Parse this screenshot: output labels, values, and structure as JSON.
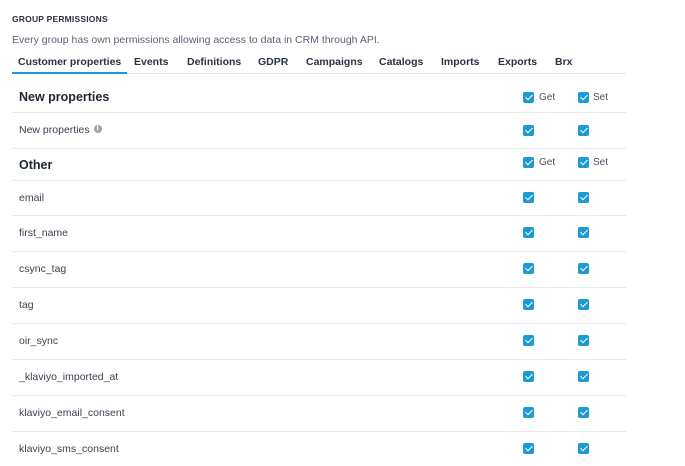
{
  "section": {
    "title": "GROUP PERMISSIONS",
    "description": "Every group has own permissions allowing access to data in CRM through API."
  },
  "tabs": [
    {
      "label": "Customer properties",
      "active": true
    },
    {
      "label": "Events"
    },
    {
      "label": "Definitions"
    },
    {
      "label": "GDPR"
    },
    {
      "label": "Campaigns"
    },
    {
      "label": "Catalogs"
    },
    {
      "label": "Imports"
    },
    {
      "label": "Exports"
    },
    {
      "label": "Brx"
    }
  ],
  "columns": {
    "get": "Get",
    "set": "Set"
  },
  "groups": {
    "new_properties": {
      "heading": "New properties",
      "rows": [
        {
          "label": "New properties",
          "get": true,
          "set": true,
          "info": true
        }
      ]
    },
    "other": {
      "heading": "Other",
      "rows": [
        {
          "label": "email",
          "get": true,
          "set": true
        },
        {
          "label": "first_name",
          "get": true,
          "set": true
        },
        {
          "label": "csync_tag",
          "get": true,
          "set": true
        },
        {
          "label": "tag",
          "get": true,
          "set": true
        },
        {
          "label": "oir_sync",
          "get": true,
          "set": true
        },
        {
          "label": "_klaviyo_imported_at",
          "get": true,
          "set": true
        },
        {
          "label": "klaviyo_email_consent",
          "get": true,
          "set": true
        },
        {
          "label": "klaviyo_sms_consent",
          "get": true,
          "set": true
        }
      ]
    }
  },
  "colors": {
    "accent": "#1d9bd1",
    "text": "#2b3340",
    "border": "#e6e9ed"
  }
}
